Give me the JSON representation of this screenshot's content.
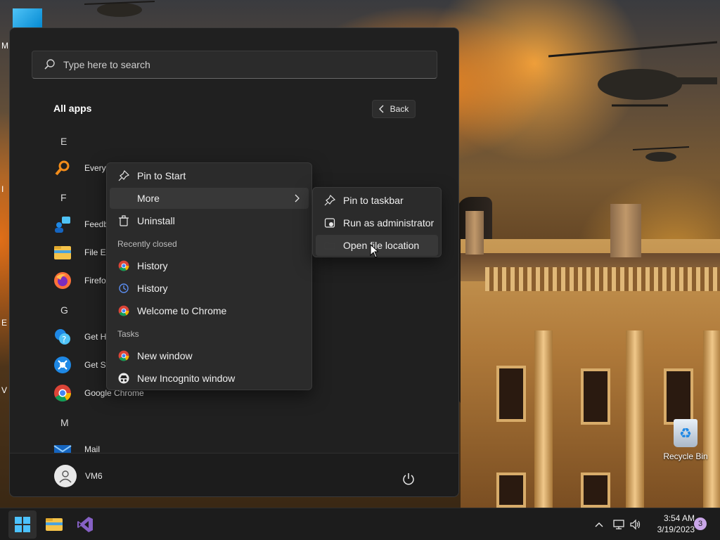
{
  "desktop": {
    "left_labels": [
      "M",
      "I",
      "E",
      "V"
    ],
    "recycle_bin_label": "Recycle Bin"
  },
  "start_menu": {
    "search": {
      "placeholder": "Type here to search"
    },
    "all_apps_title": "All apps",
    "back_label": "Back",
    "sections": [
      {
        "letter": "E",
        "apps": [
          {
            "label": "Everything",
            "icon": "everything-search-icon"
          }
        ]
      },
      {
        "letter": "F",
        "apps": [
          {
            "label": "Feedback Hub",
            "icon": "feedback-hub-icon"
          },
          {
            "label": "File Explorer",
            "icon": "folder-icon"
          },
          {
            "label": "Firefox",
            "icon": "firefox-icon"
          }
        ]
      },
      {
        "letter": "G",
        "apps": [
          {
            "label": "Get Help",
            "icon": "get-help-icon"
          },
          {
            "label": "Get Started",
            "icon": "get-started-icon"
          },
          {
            "label": "Google Chrome",
            "icon": "chrome-icon"
          }
        ]
      },
      {
        "letter": "M",
        "apps": [
          {
            "label": "Mail",
            "icon": "mail-icon"
          }
        ]
      }
    ],
    "user": {
      "name": "VM6"
    }
  },
  "context_menu": {
    "pin_to_start": "Pin to Start",
    "more": "More",
    "uninstall": "Uninstall",
    "recently_closed_heading": "Recently closed",
    "recently_closed": [
      {
        "label": "History",
        "icon": "chrome-icon"
      },
      {
        "label": "History",
        "icon": "history-icon"
      },
      {
        "label": "Welcome to Chrome",
        "icon": "chrome-icon"
      }
    ],
    "tasks_heading": "Tasks",
    "tasks": [
      {
        "label": "New window",
        "icon": "chrome-icon"
      },
      {
        "label": "New Incognito window",
        "icon": "incognito-icon"
      }
    ]
  },
  "submenu": {
    "pin_to_taskbar": "Pin to taskbar",
    "run_as_admin": "Run as administrator",
    "open_file_location": "Open file location"
  },
  "taskbar": {
    "time": "3:54 AM",
    "date": "3/19/2023",
    "notification_count": "3"
  },
  "colors": {
    "menu_bg": "#2b2b2b",
    "start_bg": "#202020",
    "taskbar_bg": "#1c1c1c",
    "accent_blue": "#0078d4"
  }
}
